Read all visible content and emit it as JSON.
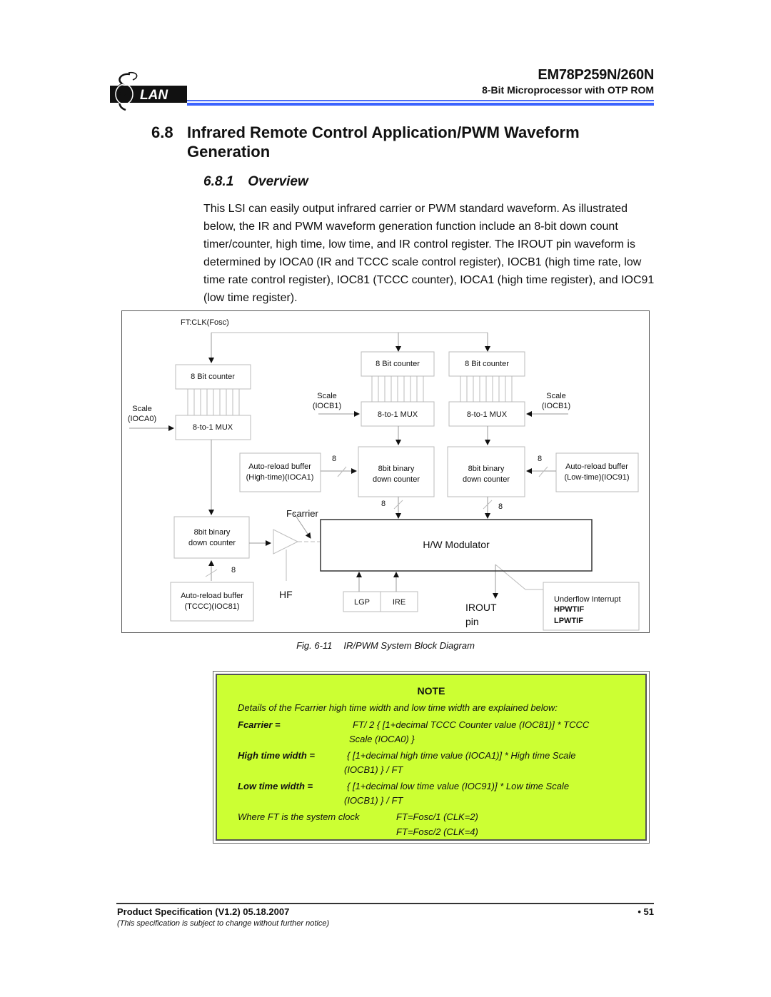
{
  "header": {
    "logo_text": "LAN",
    "logo_letter": "E",
    "product": "EM78P259N/260N",
    "subtitle": "8-Bit Microprocessor with OTP ROM",
    "rule_color": "#3b63ff"
  },
  "section": {
    "number": "6.8",
    "title": "Infrared Remote Control Application/PWM Waveform Generation"
  },
  "subsection": {
    "number": "6.8.1",
    "title": "Overview"
  },
  "body_text": "This LSI can easily output infrared carrier or PWM standard waveform.  As illustrated below, the IR and PWM waveform generation function include an 8-bit down count timer/counter, high time, low time, and IR control register. The IROUT pin waveform is determined by IOCA0 (IR and TCCC scale control register), IOCB1 (high time rate, low time rate control register), IOC81 (TCCC counter), IOCA1 (high time register), and IOC91 (low time register).",
  "diagram": {
    "clock_label": "FT:CLK(Fosc)",
    "left_counter": "8 Bit counter",
    "left_mux": "8-to-1 MUX",
    "left_scale": [
      "Scale",
      "(IOCA0)"
    ],
    "mid_counter": "8 Bit counter",
    "mid_mux": "8-to-1 MUX",
    "mid_scale": [
      "Scale",
      "(IOCB1)"
    ],
    "right_counter": "8 Bit counter",
    "right_mux": "8-to-1 MUX",
    "right_scale": [
      "Scale",
      "(IOCB1)"
    ],
    "high_buffer": [
      "Auto-reload buffer",
      "(High-time)(IOCA1)"
    ],
    "low_buffer": [
      "Auto-reload buffer",
      "(Low-time)(IOC91)"
    ],
    "high_down_counter": [
      "8bit binary",
      "down counter"
    ],
    "low_down_counter": [
      "8bit binary",
      "down counter"
    ],
    "tccc_down_counter": [
      "8bit binary",
      "down counter"
    ],
    "tccc_buffer": [
      "Auto-reload buffer",
      "(TCCC)(IOC81)"
    ],
    "bus_width": "8",
    "fcarrier": "Fcarrier",
    "hf": "HF",
    "modulator": "H/W Modulator",
    "lgp": "LGP",
    "ire": "IRE",
    "irout": [
      "IROUT",
      "pin"
    ],
    "interrupt": [
      "Underflow Interrupt",
      "HPWTIF",
      "LPWTIF"
    ]
  },
  "figure_caption": {
    "number": "Fig. 6-11",
    "title": "IR/PWM System Block Diagram"
  },
  "note": {
    "title": "NOTE",
    "intro": "Details of the Fcarrier high time width and low time width are explained below:",
    "fcarrier_key": "Fcarrier =",
    "fcarrier_val1": "FT/ 2 { [1+decimal TCCC Counter value (IOC81)] * TCCC",
    "fcarrier_val2": "Scale (IOCA0) }",
    "high_key": "High time width =",
    "high_val1": "{ [1+decimal high time value (IOCA1)] * High time Scale",
    "high_val2": "(IOCB1) } / FT",
    "low_key": "Low time width =",
    "low_val1": "{ [1+decimal low time value (IOC91)] * Low time Scale",
    "low_val2": "(IOCB1) } / FT",
    "ft_key": "Where FT is the system clock",
    "ft_val1": "FT=Fosc/1 (CLK=2)",
    "ft_val2": "FT=Fosc/2 (CLK=4)",
    "background": "#ccff33"
  },
  "footer": {
    "spec": "Product Specification (V1.2) 05.18.2007",
    "page": "• 51",
    "disclaimer": "(This specification is subject to change without further notice)"
  }
}
